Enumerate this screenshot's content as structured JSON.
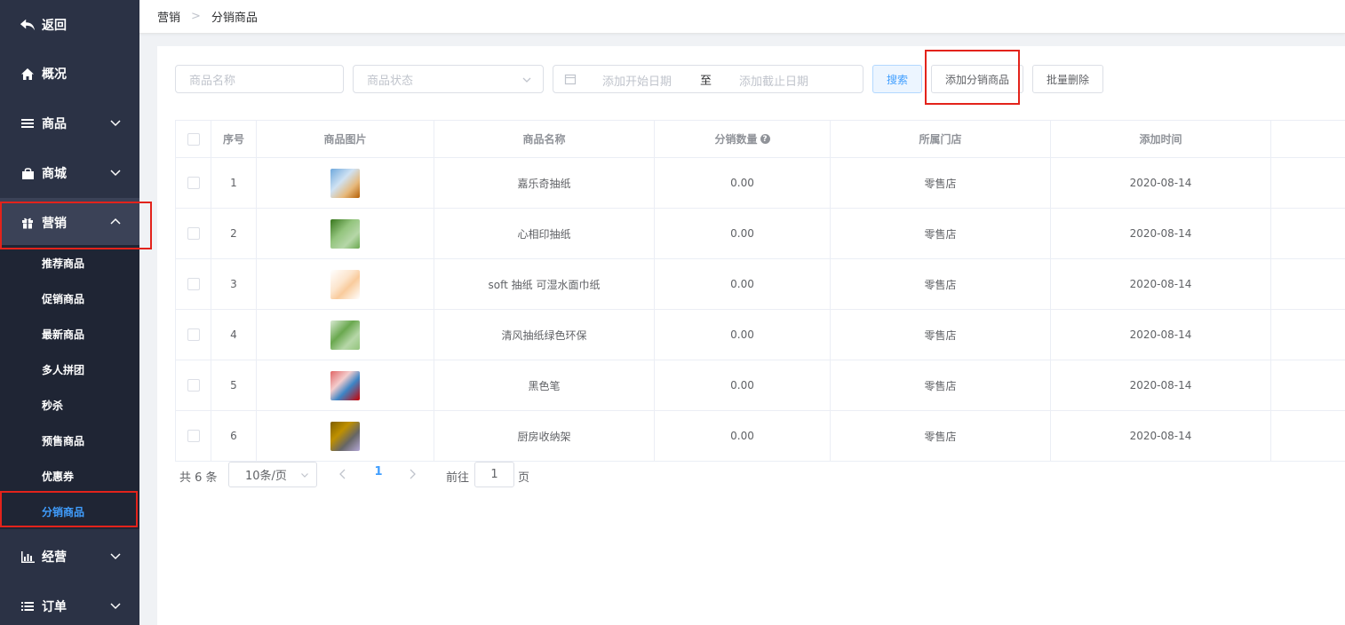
{
  "sidebar": {
    "back": "返回",
    "items": [
      {
        "label": "概况",
        "icon": "home-icon"
      },
      {
        "label": "商品",
        "icon": "list-icon"
      },
      {
        "label": "商城",
        "icon": "shop-bag-icon"
      },
      {
        "label": "营销",
        "icon": "gift-icon"
      },
      {
        "label": "经营",
        "icon": "bar-chart-icon"
      },
      {
        "label": "订单",
        "icon": "list-icon"
      }
    ],
    "submenu": [
      "推荐商品",
      "促销商品",
      "最新商品",
      "多人拼团",
      "秒杀",
      "预售商品",
      "优惠券",
      "分销商品"
    ]
  },
  "breadcrumb": {
    "parent": "营销",
    "current": "分销商品"
  },
  "filters": {
    "name_placeholder": "商品名称",
    "status_placeholder": "商品状态",
    "start_date_placeholder": "添加开始日期",
    "range_separator": "至",
    "end_date_placeholder": "添加截止日期"
  },
  "actions": {
    "search": "搜索",
    "add": "添加分销商品",
    "batch_delete": "批量删除"
  },
  "table": {
    "headers": [
      "序号",
      "商品图片",
      "商品名称",
      "分销数量",
      "所属门店",
      "添加时间"
    ],
    "rows": [
      {
        "no": "1",
        "name": "嘉乐奇抽纸",
        "qty": "0.00",
        "store": "零售店",
        "date": "2020-08-14"
      },
      {
        "no": "2",
        "name": "心相印抽纸",
        "qty": "0.00",
        "store": "零售店",
        "date": "2020-08-14"
      },
      {
        "no": "3",
        "name": "soft 抽纸 可湿水面巾纸",
        "qty": "0.00",
        "store": "零售店",
        "date": "2020-08-14"
      },
      {
        "no": "4",
        "name": "清风抽纸绿色环保",
        "qty": "0.00",
        "store": "零售店",
        "date": "2020-08-14"
      },
      {
        "no": "5",
        "name": "黑色笔",
        "qty": "0.00",
        "store": "零售店",
        "date": "2020-08-14"
      },
      {
        "no": "6",
        "name": "厨房收纳架",
        "qty": "0.00",
        "store": "零售店",
        "date": "2020-08-14"
      }
    ]
  },
  "pagination": {
    "total": "共 6 条",
    "page_size": "10条/页",
    "current": "1",
    "goto": "前往",
    "goto_value": "1",
    "page_unit": "页"
  },
  "colors": {
    "sidebar": "#2b3245",
    "submenu": "#1f2534",
    "accent": "#409eff",
    "highlight": "#e3231b"
  }
}
